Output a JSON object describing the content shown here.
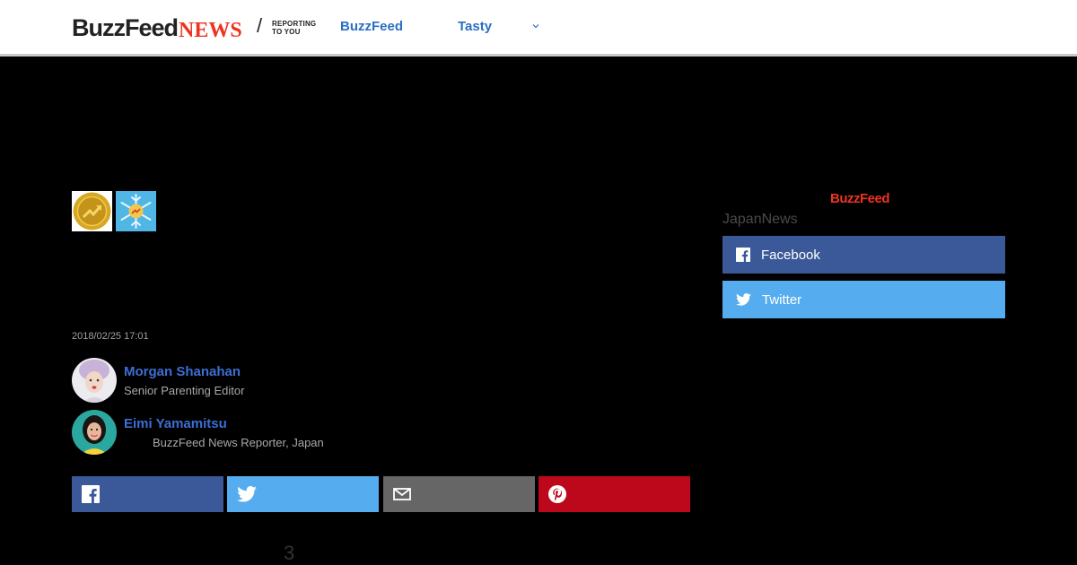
{
  "header": {
    "logo_main": "BuzzFeed",
    "logo_accent": "NEWS",
    "slash": "/",
    "tagline_line1": "REPORTING",
    "tagline_line2": "TO YOU",
    "nav": [
      {
        "label": "BuzzFeed"
      },
      {
        "label": "Tasty"
      }
    ]
  },
  "article": {
    "timestamp": "2018/02/25 17:01",
    "authors": [
      {
        "name": "Morgan Shanahan",
        "title": "Senior Parenting Editor"
      },
      {
        "name": "Eimi Yamamitsu",
        "title": "BuzzFeed News Reporter, Japan"
      }
    ],
    "share_count": "3"
  },
  "sidebar": {
    "brand": "BuzzFeed",
    "label": "JapanNews",
    "buttons": [
      {
        "label": "Facebook"
      },
      {
        "label": "Twitter"
      }
    ]
  },
  "colors": {
    "facebook": "#3b5998",
    "twitter": "#55acee",
    "email": "#666666",
    "pinterest": "#bd081c",
    "accent": "#ee3322",
    "link": "#2a6ec4"
  }
}
